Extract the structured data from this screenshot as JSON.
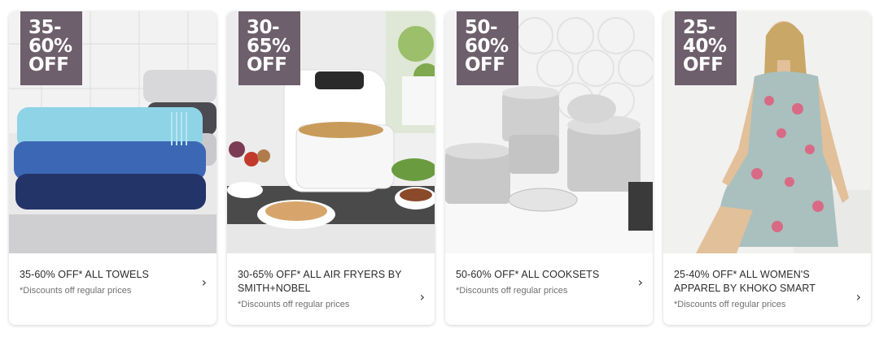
{
  "promos": [
    {
      "badge": {
        "line1": "35-",
        "line2": "60%",
        "line3": "OFF"
      },
      "title": "35-60% OFF* ALL TOWELS",
      "subtitle": "*Discounts off regular prices",
      "image_icon": "towels-image"
    },
    {
      "badge": {
        "line1": "30-",
        "line2": "65%",
        "line3": "OFF"
      },
      "title": "30-65% OFF* ALL AIR FRYERS BY SMITH+NOBEL",
      "subtitle": "*Discounts off regular prices",
      "image_icon": "air-fryer-image"
    },
    {
      "badge": {
        "line1": "50-",
        "line2": "60%",
        "line3": "OFF"
      },
      "title": "50-60% OFF* ALL COOKSETS",
      "subtitle": "*Discounts off regular prices",
      "image_icon": "cookset-image"
    },
    {
      "badge": {
        "line1": "25-",
        "line2": "40%",
        "line3": "OFF"
      },
      "title": "25-40% OFF* ALL WOMEN'S APPAREL BY KHOKO SMART",
      "subtitle": "*Discounts off regular prices",
      "image_icon": "dress-model-image"
    }
  ],
  "colors": {
    "badge_bg": "#6e5f6c",
    "title_text": "#2b2b2b",
    "subtitle_text": "#6f6f6f"
  }
}
